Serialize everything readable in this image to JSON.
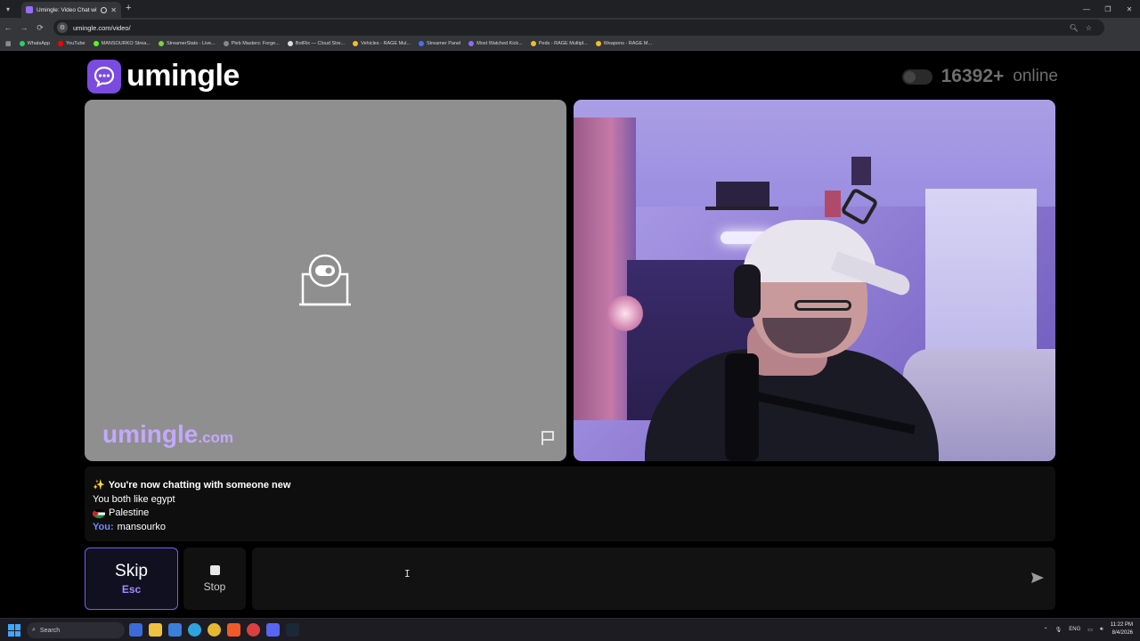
{
  "browser": {
    "tab_title": "Umingle: Video Chat with S",
    "url": "umingle.com/video/",
    "bookmarks": [
      {
        "label": "WhatsApp",
        "color": "#25d366"
      },
      {
        "label": "YouTube",
        "color": "#ff0000"
      },
      {
        "label": "MANSOURKO Strea...",
        "color": "#53fc18"
      },
      {
        "label": "StreamerStats - Live...",
        "color": "#7cd04a"
      },
      {
        "label": "Pleb Masters: Forge...",
        "color": "#888888"
      },
      {
        "label": "BotRix — Cloud Stre...",
        "color": "#dddddd"
      },
      {
        "label": "Vehicles - RAGE Mul...",
        "color": "#f0c020"
      },
      {
        "label": "Streamer Panel",
        "color": "#4a6cff"
      },
      {
        "label": "Most Watched Kick...",
        "color": "#8a6cff"
      },
      {
        "label": "Peds - RAGE Multipl...",
        "color": "#f0c020"
      },
      {
        "label": "Weapons - RAGE M...",
        "color": "#f0c020"
      }
    ]
  },
  "header": {
    "logo_text": "umingle",
    "online_count": "16392+",
    "online_label": "online"
  },
  "left_video": {
    "watermark_main": "umingle",
    "watermark_domain": ".com"
  },
  "chat": {
    "lines": [
      {
        "prefix": "✨",
        "text": "You're now chatting with someone new"
      },
      {
        "text": "You both like egypt"
      },
      {
        "text": "Palestine"
      },
      {
        "speaker": "You:",
        "text": "mansourko"
      }
    ]
  },
  "controls": {
    "skip_label": "Skip",
    "skip_key": "Esc",
    "stop_label": "Stop",
    "message_value": ""
  },
  "taskbar": {
    "search_label": "Search",
    "language": "ENG",
    "time": "11:22 PM",
    "date": "8/4/2026"
  },
  "colors": {
    "accent": "#7b4be0",
    "watermark": "#c4a8ff",
    "you_label": "#6d8cff"
  }
}
